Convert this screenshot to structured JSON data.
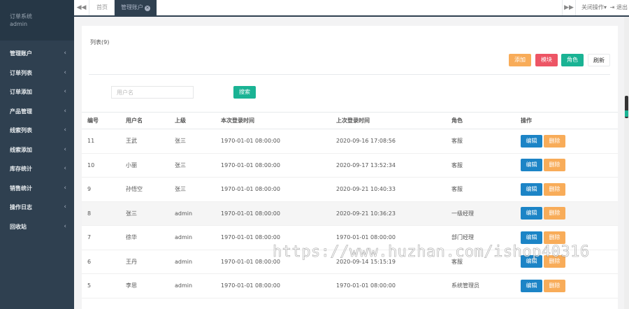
{
  "sidebar": {
    "system_name": "订单系统",
    "user": "admin",
    "items": [
      {
        "label": "管理账户"
      },
      {
        "label": "订单列表"
      },
      {
        "label": "订单添加"
      },
      {
        "label": "产品管理"
      },
      {
        "label": "线索列表"
      },
      {
        "label": "线索添加"
      },
      {
        "label": "库存统计"
      },
      {
        "label": "销售统计"
      },
      {
        "label": "操作日志"
      },
      {
        "label": "回收站"
      }
    ],
    "chevron": "‹"
  },
  "topbar": {
    "back_icon": "◀◀",
    "home_tab": "首页",
    "active_tab": "管理账户",
    "forward_icon": "▶▶",
    "close_ops": "关闭操作▾",
    "logout": "⇥ 退出"
  },
  "main": {
    "list_title": "列表(9)",
    "buttons": {
      "add": "添加",
      "module": "模块",
      "role": "角色",
      "refresh": "刷新"
    },
    "search": {
      "placeholder": "用户名",
      "value": "",
      "button": "搜索"
    },
    "table": {
      "headers": [
        "编号",
        "用户名",
        "上级",
        "本次登录时间",
        "上次登录时间",
        "角色",
        "操作"
      ],
      "edit_label": "编辑",
      "delete_label": "删除",
      "rows": [
        {
          "id": "11",
          "name": "王武",
          "parent": "张三",
          "this_login": "1970-01-01 08:00:00",
          "last_login": "2020-09-16 17:08:56",
          "role": "客服"
        },
        {
          "id": "10",
          "name": "小丽",
          "parent": "张三",
          "this_login": "1970-01-01 08:00:00",
          "last_login": "2020-09-17 13:52:34",
          "role": "客服"
        },
        {
          "id": "9",
          "name": "孙悟空",
          "parent": "张三",
          "this_login": "1970-01-01 08:00:00",
          "last_login": "2020-09-21 10:40:33",
          "role": "客服"
        },
        {
          "id": "8",
          "name": "张三",
          "parent": "admin",
          "this_login": "1970-01-01 08:00:00",
          "last_login": "2020-09-21 10:36:23",
          "role": "一级经理"
        },
        {
          "id": "7",
          "name": "徐华",
          "parent": "admin",
          "this_login": "1970-01-01 08:00:00",
          "last_login": "1970-01-01 08:00:00",
          "role": "部门经理"
        },
        {
          "id": "6",
          "name": "王丹",
          "parent": "admin",
          "this_login": "1970-01-01 08:00:00",
          "last_login": "2020-09-14 15:15:19",
          "role": "客服"
        },
        {
          "id": "5",
          "name": "李思",
          "parent": "admin",
          "this_login": "1970-01-01 08:00:00",
          "last_login": "1970-01-01 08:00:00",
          "role": "系统管理员"
        }
      ]
    }
  },
  "watermark": "https://www.huzhan.com/ishop40316",
  "colors": {
    "sidebar": "#2f4050",
    "primary": "#1ab394",
    "warning": "#f8ac59",
    "danger": "#ed5565",
    "info": "#1c84c6"
  }
}
